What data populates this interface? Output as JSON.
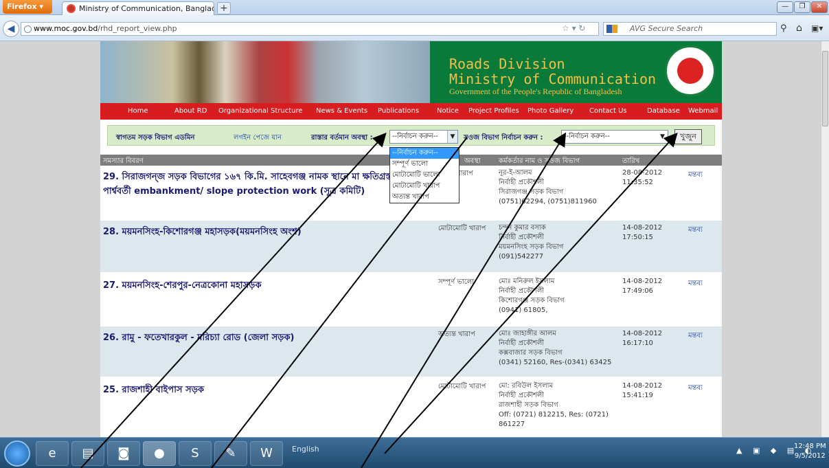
{
  "browser": {
    "app_button": "Firefox",
    "tab_title": "Ministry of Communication, Bangladesh",
    "url_host": "www.moc.gov.bd",
    "url_path": "/rhd_report_view.php",
    "search_placeholder": "AVG Secure Search"
  },
  "banner": {
    "title_line1": "Roads Division",
    "title_line2": "Ministry of Communication",
    "subtitle": "Government of the People's Republic of Bangladesh"
  },
  "menu": [
    "Home",
    "About RD",
    "Organizational Structure",
    "News & Events",
    "Publications",
    "Notice",
    "Project Profiles",
    "Photo Gallery",
    "Contact Us",
    "Database",
    "Webmail"
  ],
  "filters": {
    "admin_label": "স্বাগতম সড়ক বিভাগ এডমিন",
    "logout_label": "লগইন পেজে যান",
    "road_status_label": "রাস্তার বর্তমান অবস্থা :",
    "road_status_value": "--নির্বাচন করুন--",
    "division_label": "সওজ বিভাগ নির্বাচন করুন :",
    "division_value": "--নির্বাচন করুন--",
    "search_button": "খুজুন"
  },
  "dropdown_options": [
    "--নির্বাচন করুন--",
    "সম্পূর্ণ ভালো",
    "মোটামোটি ভালো",
    "মোটামোটি খারাপ",
    "অত্যন্ত খারাপ"
  ],
  "table": {
    "headers": [
      "সমস্যার বিবরণ",
      "অবস্থা",
      "কর্মকর্তার নাম ও সওজ বিভাগ",
      "তারিখ"
    ],
    "rows": [
      {
        "title": "29. সিরাজগন্জ সড়ক বিভাগের ১৬৭ কি.মি. সাহেবগঞ্জ নামক স্থানে মা ক্ষতিগ্রস্ত নদীর পার্শ্ববর্তী embankment/ slope protection work (সূত্র কমিটি)",
        "status": "খারাপ",
        "officer": [
          "নূর-ই-আলম",
          "নির্বাহী প্রকৌশলী",
          "সিরাজগঞ্জ সড়ক বিভাগ",
          "(0751)62294, (0751)811960"
        ],
        "date": [
          "28-08-2012",
          "11:35:52"
        ],
        "comment": "মন্তব্য"
      },
      {
        "title": "28. ময়মনসিংহ-কিশোরগঞ্জ মহাসড়ক(ময়মনসিংহ অংশ)",
        "status": "মোটামোটি খারাপ",
        "officer": [
          "চন্দন কুমার বসাক",
          "নির্বাহী প্রকৌশলী",
          "ময়মনসিংহ সড়ক বিভাগ",
          "(091)542277"
        ],
        "date": [
          "14-08-2012",
          "17:50:15"
        ],
        "comment": "মন্তব্য"
      },
      {
        "title": "27. ময়মনসিংহ-শেরপুর-নেত্রকোনা মহাসড়ক",
        "status": "সম্পূর্ণ ভালো",
        "officer": [
          "মোঃ মনিরুল ইসলাম",
          "নির্বাহী প্রকৌশলী",
          "কিশোরগঞ্জ সড়ক বিভাগ",
          "(0941) 61805,"
        ],
        "date": [
          "14-08-2012",
          "17:49:06"
        ],
        "comment": "মন্তব্য"
      },
      {
        "title": "26. রামু - ফতেখারকুল - মরিচ্যা রোড (জেলা সড়ক)",
        "status": "অত্যন্ত খারাপ",
        "officer": [
          "মোঃ জাহাঙ্গীর আলম",
          "নির্বাহী প্রকৌশলী",
          "কক্সবাজার সড়ক বিভাগ",
          "(0341) 52160, Res-(0341) 63425"
        ],
        "date": [
          "14-08-2012",
          "16:17:10"
        ],
        "comment": "মন্তব্য"
      },
      {
        "title": "25. রাজশাহী বাইপাস সড়ক",
        "status": "মোটামোটি খারাপ",
        "officer": [
          "মো: রবিউল ইসলাম",
          "নির্বাহী প্রকৌশলী",
          "রাজশাহী সড়ক বিভাগ",
          "Off: (0721) 812215, Res: (0721) 861227"
        ],
        "date": [
          "14-08-2012",
          "15:41:19"
        ],
        "comment": "মন্তব্য"
      }
    ]
  },
  "taskbar": {
    "language": "English",
    "time": "12:48 PM",
    "date": "9/5/2012"
  }
}
